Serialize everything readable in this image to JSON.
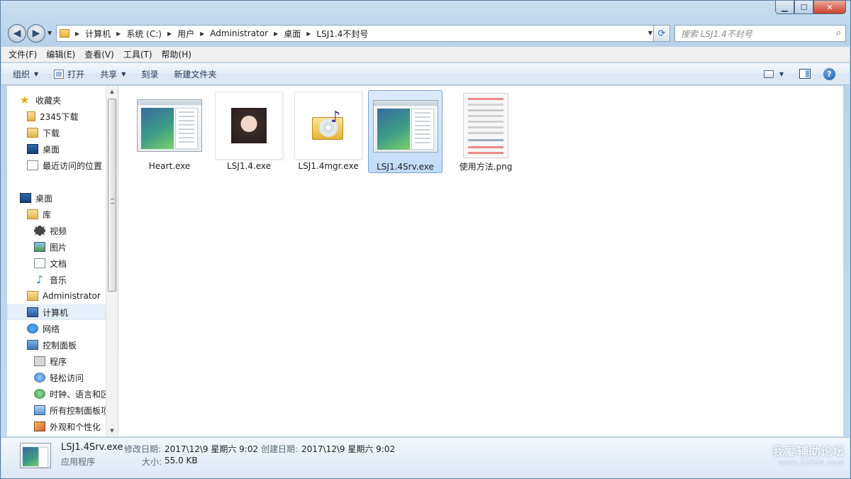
{
  "window": {
    "min_label": "▁",
    "max_label": "☐",
    "close_label": "✕"
  },
  "address": {
    "segments": [
      "计算机",
      "系统 (C:)",
      "用户",
      "Administrator",
      "桌面",
      "LSJ1.4不封号"
    ]
  },
  "search": {
    "placeholder": "搜索 LSJ1.4不封号"
  },
  "menu": [
    "文件(F)",
    "编辑(E)",
    "查看(V)",
    "工具(T)",
    "帮助(H)"
  ],
  "commands": {
    "organize": "组织",
    "open": "打开",
    "share": "共享",
    "burn": "刻录",
    "new_folder": "新建文件夹"
  },
  "navpane": {
    "favorites": "收藏夹",
    "fav_items": [
      "2345下载",
      "下载",
      "桌面",
      "最近访问的位置"
    ],
    "desktop": "桌面",
    "library": "库",
    "lib_items": [
      "视频",
      "图片",
      "文档",
      "音乐"
    ],
    "admin": "Administrator",
    "computer": "计算机",
    "network": "网络",
    "control_panel": "控制面板",
    "cp_items": [
      "程序",
      "轻松访问",
      "时钟、语言和区",
      "所有控制面板项",
      "外观和个性化"
    ]
  },
  "files": [
    {
      "name": "Heart.exe"
    },
    {
      "name": "LSJ1.4.exe"
    },
    {
      "name": "LSJ1.4mgr.exe"
    },
    {
      "name": "LSJ1.4Srv.exe"
    },
    {
      "name": "使用方法.png"
    }
  ],
  "details": {
    "filename": "LSJ1.4Srv.exe",
    "type": "应用程序",
    "modified_label": "修改日期:",
    "modified_value": "2017\\12\\9 星期六 9:02",
    "created_label": "创建日期:",
    "created_value": "2017\\12\\9 星期六 9:02",
    "size_label": "大小:",
    "size_value": "55.0 KB"
  },
  "watermark": {
    "line1": "我爱辅助论坛",
    "line2": "www.52fzlt.com"
  }
}
